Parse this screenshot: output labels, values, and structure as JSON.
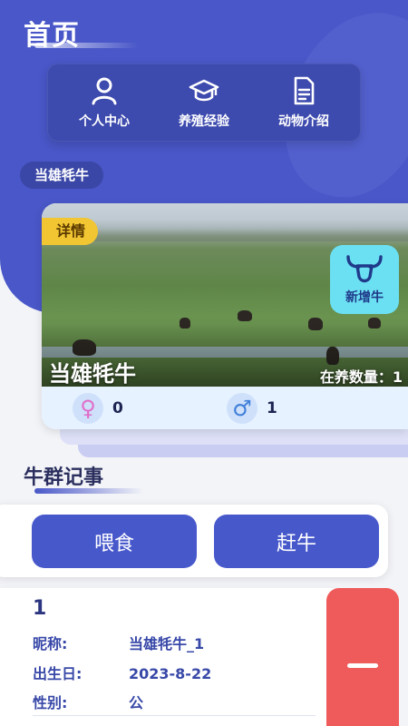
{
  "header": {
    "title": "首页"
  },
  "quick_menu": [
    {
      "label": "个人中心",
      "icon": "person-icon"
    },
    {
      "label": "养殖经验",
      "icon": "graduation-cap-icon"
    },
    {
      "label": "动物介绍",
      "icon": "document-icon"
    }
  ],
  "breed_chip": "当雄牦牛",
  "breed_card": {
    "detail_tag": "详情",
    "add_label": "新增牛",
    "name": "当雄牦牛",
    "count_label": "在养数量：1",
    "female_count": "0",
    "male_count": "1",
    "female_symbol": "♀",
    "male_symbol": "♂"
  },
  "section": {
    "title": "牛群记事"
  },
  "actions": {
    "feed": "喂食",
    "herd": "赶牛"
  },
  "record": {
    "id": "1",
    "nickname_label": "昵称:",
    "nickname": "当雄牦牛_1",
    "birthday_label": "出生日:",
    "birthday": "2023-8-22",
    "gender_label": "性别:",
    "gender": "公"
  },
  "colors": {
    "primary": "#4957c8",
    "accent_yellow": "#f2c632",
    "add_cyan": "#6be0f2",
    "delete_red": "#ef5a5a"
  }
}
